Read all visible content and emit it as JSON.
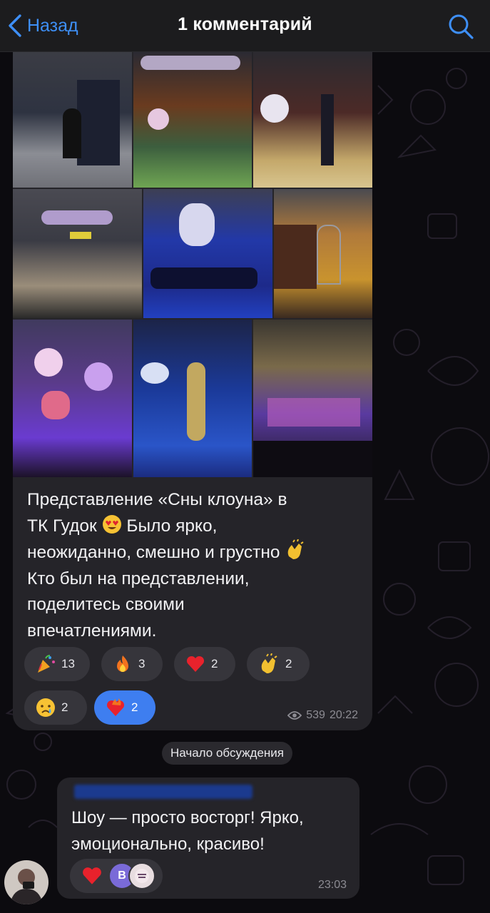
{
  "header": {
    "back_label": "Назад",
    "title": "1 комментарий"
  },
  "post": {
    "photos_count": 9,
    "text": "Представление «Сны клоуна» в ТК Гудок 😍 Было ярко, неожиданно, смешно и грустно 👏 Кто был на представлении, поделитесь своими впечатлениями.",
    "text_lines": [
      "Представление «Сны клоуна» в",
      "ТК Гудок",
      "Было ярко,",
      "неожиданно, смешно и грустно",
      "Кто был на представлении,",
      "поделитесь своими",
      "впечатлениями."
    ],
    "reactions": [
      {
        "icon": "party-popper-icon",
        "count": "13"
      },
      {
        "icon": "fire-icon",
        "count": "3"
      },
      {
        "icon": "heart-icon",
        "count": "2"
      },
      {
        "icon": "clapping-hands-icon",
        "count": "2"
      },
      {
        "icon": "crying-face-icon",
        "count": "2"
      },
      {
        "icon": "burning-heart-icon",
        "count": "2",
        "active": true
      }
    ],
    "views": "539",
    "time": "20:22"
  },
  "discussion_chip": "Начало обсуждения",
  "comment": {
    "text_lines": [
      "Шоу — просто восторг! Ярко,",
      "эмоционально, красиво!"
    ],
    "reaction": {
      "icon": "heart-icon",
      "avatar_letter": "В"
    },
    "time": "23:03"
  },
  "colors": {
    "accent": "#3e8ff6",
    "bubble": "#252429",
    "reaction_active": "#3e7ef0",
    "header_bg": "#1c1c1e"
  }
}
